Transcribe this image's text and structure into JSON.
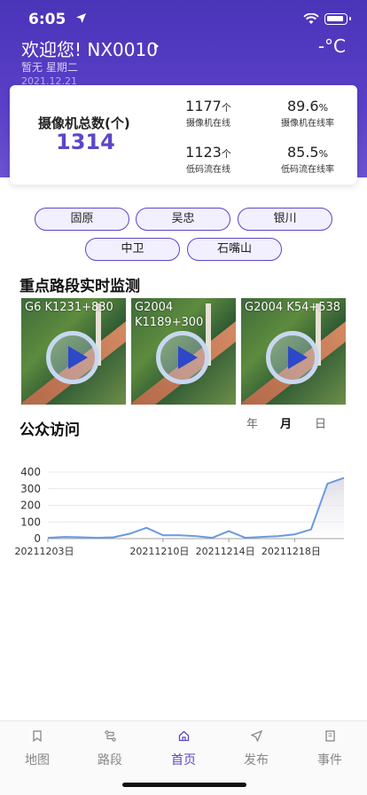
{
  "status_bar": {
    "time": "6:05"
  },
  "header": {
    "greeting": "欢迎您! NX0010",
    "temperature": "-°C",
    "weather": "暂无 星期二",
    "date": "2021.12.21"
  },
  "summary": {
    "total_label": "摄像机总数(个)",
    "total_value": "1314",
    "stats": [
      {
        "value": "1177",
        "unit": "个",
        "label": "摄像机在线"
      },
      {
        "value": "89.6",
        "unit": "%",
        "label": "摄像机在线率"
      },
      {
        "value": "1123",
        "unit": "个",
        "label": "低码流在线"
      },
      {
        "value": "85.5",
        "unit": "%",
        "label": "低码流在线率"
      }
    ]
  },
  "regions": [
    "固原",
    "吴忠",
    "银川",
    "中卫",
    "石嘴山"
  ],
  "monitor": {
    "title": "重点路段实时监测",
    "videos": [
      {
        "title": "G6 K1231+830"
      },
      {
        "title": "G2004 K1189+300"
      },
      {
        "title": "G2004 K54+538"
      }
    ]
  },
  "visits": {
    "title": "公众访问",
    "periods": [
      "年",
      "月",
      "日"
    ],
    "active_period": "月"
  },
  "chart_data": {
    "type": "area",
    "x": [
      "20211203日",
      "20211204日",
      "20211205日",
      "20211206日",
      "20211207日",
      "20211208日",
      "20211209日",
      "20211210日",
      "20211211日",
      "20211212日",
      "20211213日",
      "20211214日",
      "20211215日",
      "20211216日",
      "20211217日",
      "20211218日",
      "20211219日",
      "20211220日",
      "20211221日"
    ],
    "x_tick_labels": [
      "20211203日",
      "20211210日",
      "20211214日",
      "20211218日"
    ],
    "y_tick_labels": [
      "0",
      "100",
      "200",
      "300",
      "400"
    ],
    "ylim": [
      0,
      400
    ],
    "series": [
      {
        "values": [
          5,
          10,
          8,
          5,
          8,
          30,
          65,
          20,
          20,
          15,
          5,
          45,
          5,
          10,
          15,
          25,
          55,
          330,
          365
        ]
      }
    ],
    "colors": {
      "line": "#6a9ae0",
      "fill_top": "#e4e4ec"
    },
    "grid": true
  },
  "tabbar": {
    "tabs": [
      {
        "label": "地图",
        "icon": "map-icon"
      },
      {
        "label": "路段",
        "icon": "route-icon"
      },
      {
        "label": "首页",
        "icon": "home-icon"
      },
      {
        "label": "发布",
        "icon": "send-icon"
      },
      {
        "label": "事件",
        "icon": "event-icon"
      }
    ],
    "active_index": 2
  },
  "colors": {
    "brand": "#5a48c8",
    "header_top": "#4a34b8"
  }
}
